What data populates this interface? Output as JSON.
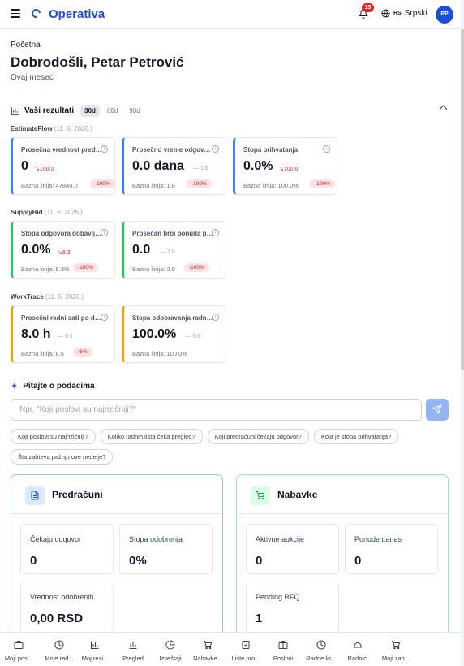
{
  "app": {
    "brand": "Operativa",
    "notifications": "15",
    "language_code": "RS",
    "language": "Srpski",
    "user_initials": "PP"
  },
  "header": {
    "breadcrumb": "Početna",
    "welcome": "Dobrodošli, Petar Petrović",
    "period": "Ovaj mesec"
  },
  "results": {
    "title": "Vaši rezultati",
    "ranges": [
      "30d",
      "60d",
      "90d"
    ],
    "active_range": "30d",
    "groups": [
      {
        "name": "EstimateFlow",
        "date": "(11. 6. 2026.)",
        "cards": [
          {
            "label": "Prosečna vrednost predračuna",
            "value": "0",
            "delta": "100.0",
            "trend": "down",
            "baseline": "Bazna linija: 47840.0",
            "change": "-100%"
          },
          {
            "label": "Prosečno vreme odgovora",
            "value": "0.0 dana",
            "delta": "1.6",
            "trend": "flat",
            "baseline": "Bazna linija: 1.6",
            "change": "-100%"
          },
          {
            "label": "Stopa prihvatanja",
            "value": "0.0%",
            "delta": "100.0",
            "trend": "down",
            "baseline": "Bazna linija: 100.0%",
            "change": "-100%"
          }
        ]
      },
      {
        "name": "SupplyBid",
        "date": "(11. 6. 2026.)",
        "cards": [
          {
            "label": "Stopa odgovora dobavljača",
            "value": "0.0%",
            "delta": "8.3",
            "trend": "down",
            "baseline": "Bazna linija: 8.3%",
            "change": "-100%"
          },
          {
            "label": "Prosečan broj ponuda po RFQ",
            "value": "0.0",
            "delta": "2.0",
            "trend": "flat",
            "baseline": "Bazna linija: 2.0",
            "change": "-100%"
          }
        ]
      },
      {
        "name": "WorkTrace",
        "date": "(11. 6. 2026.)",
        "cards": [
          {
            "label": "Prosečni radni sati po danu",
            "value": "8.0 h",
            "delta": "0.5",
            "trend": "flat",
            "baseline": "Bazna linija: 8.5",
            "change": "-6%"
          },
          {
            "label": "Stopa odobravanja radnih listi",
            "value": "100.0%",
            "delta": "0.0",
            "trend": "flat",
            "baseline": "Bazna linija: 100.0%",
            "change": ""
          }
        ]
      }
    ]
  },
  "ask": {
    "title": "Pitajte o podacima",
    "placeholder": "Npr. \"Koji poslovi su najrizičniji?\"",
    "suggestions": [
      "Koji poslovi su najrizičniji?",
      "Koliko radnih lista čeka pregled?",
      "Koji predračuni čekaju odgovor?",
      "Koja je stopa prihvatanja?",
      "Šta zahteva pažnju ove nedelje?"
    ]
  },
  "panels": [
    {
      "title": "Predračuni",
      "icon": "document-icon",
      "stats": [
        {
          "label": "Čekaju odgovor",
          "value": "0"
        },
        {
          "label": "Stopa odobrenja",
          "value": "0%"
        },
        {
          "label": "Vrednost odobrenih",
          "value": "0,00 RSD"
        }
      ]
    },
    {
      "title": "Nabavke",
      "icon": "cart-icon",
      "stats": [
        {
          "label": "Aktivne aukcije",
          "value": "0"
        },
        {
          "label": "Ponude danas",
          "value": "0"
        },
        {
          "label": "Pending RFQ",
          "value": "1"
        }
      ]
    }
  ],
  "bottom_nav": [
    "Moji pos...",
    "Moje rad...",
    "Moj rezi...",
    "Pregled",
    "Izveštaji",
    "Nabavke...",
    "Liste pro...",
    "Poslovi",
    "Radne lis...",
    "Radnici",
    "Moji zah..."
  ],
  "colors": {
    "brand": "#1d4ed8",
    "estimateflow": "#3b82f6",
    "supplybid": "#22c55e",
    "worktrace": "#f59e0b",
    "negative": "#dc2626"
  }
}
